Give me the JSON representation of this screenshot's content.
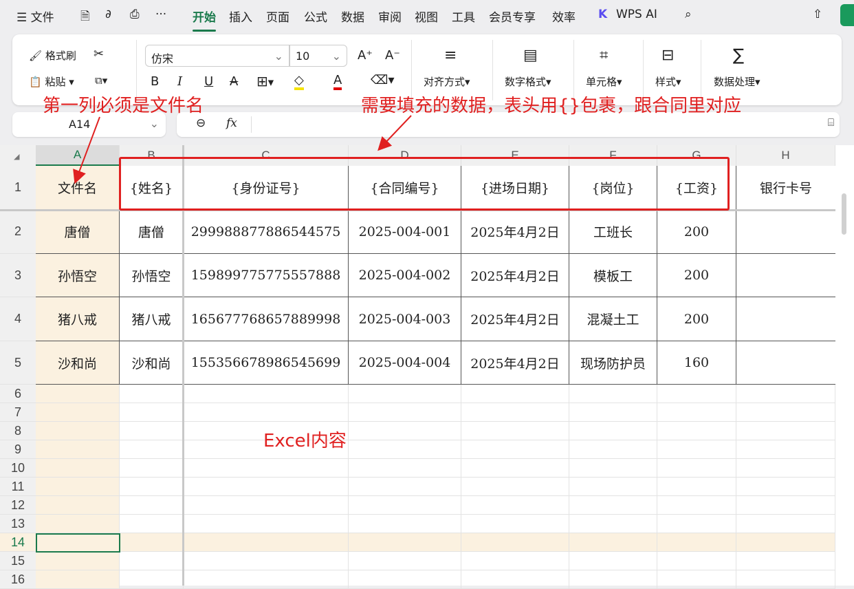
{
  "menu": {
    "file": "文件",
    "more": "···",
    "tabs": [
      "开始",
      "插入",
      "页面",
      "公式",
      "数据",
      "审阅",
      "视图",
      "工具",
      "会员专享",
      "效率"
    ],
    "wps_ai": "WPS AI"
  },
  "ribbon": {
    "format_painter": "格式刷",
    "paste": "粘贴",
    "font": "仿宋",
    "size": "10",
    "bold": "B",
    "italic": "I",
    "underline": "U",
    "strike": "A",
    "align": "对齐方式",
    "number_format": "数字格式",
    "cell": "单元格",
    "style": "样式",
    "data_process": "数据处理"
  },
  "formula_bar": {
    "name_box": "A14",
    "fx": "fx",
    "value": ""
  },
  "columns": [
    "A",
    "B",
    "C",
    "D",
    "E",
    "F",
    "G",
    "H"
  ],
  "rows": [
    [
      "文件名",
      "{姓名}",
      "{身份证号}",
      "{合同编号}",
      "{进场日期}",
      "{岗位}",
      "{工资}",
      "银行卡号"
    ],
    [
      "唐僧",
      "唐僧",
      "299988877886544575",
      "2025-004-001",
      "2025年4月2日",
      "工班长",
      "200",
      ""
    ],
    [
      "孙悟空",
      "孙悟空",
      "159899775775557888",
      "2025-004-002",
      "2025年4月2日",
      "模板工",
      "200",
      ""
    ],
    [
      "猪八戒",
      "猪八戒",
      "165677768657889998",
      "2025-004-003",
      "2025年4月2日",
      "混凝土工",
      "200",
      ""
    ],
    [
      "沙和尚",
      "沙和尚",
      "155356678986545699",
      "2025-004-004",
      "2025年4月2日",
      "现场防护员",
      "160",
      ""
    ]
  ],
  "row_numbers": [
    "1",
    "2",
    "3",
    "4",
    "5",
    "6",
    "7",
    "8",
    "9",
    "10",
    "11",
    "12",
    "13",
    "14",
    "15",
    "16"
  ],
  "annotations": {
    "first_col": "第一列必须是文件名",
    "header_note": "需要填充的数据，表头用{}包裹，跟合同里对应",
    "content": "Excel内容"
  },
  "colors": {
    "accent": "#1a7a4c",
    "annotation": "#e02020",
    "first_col_bg": "#fbf1e0"
  }
}
